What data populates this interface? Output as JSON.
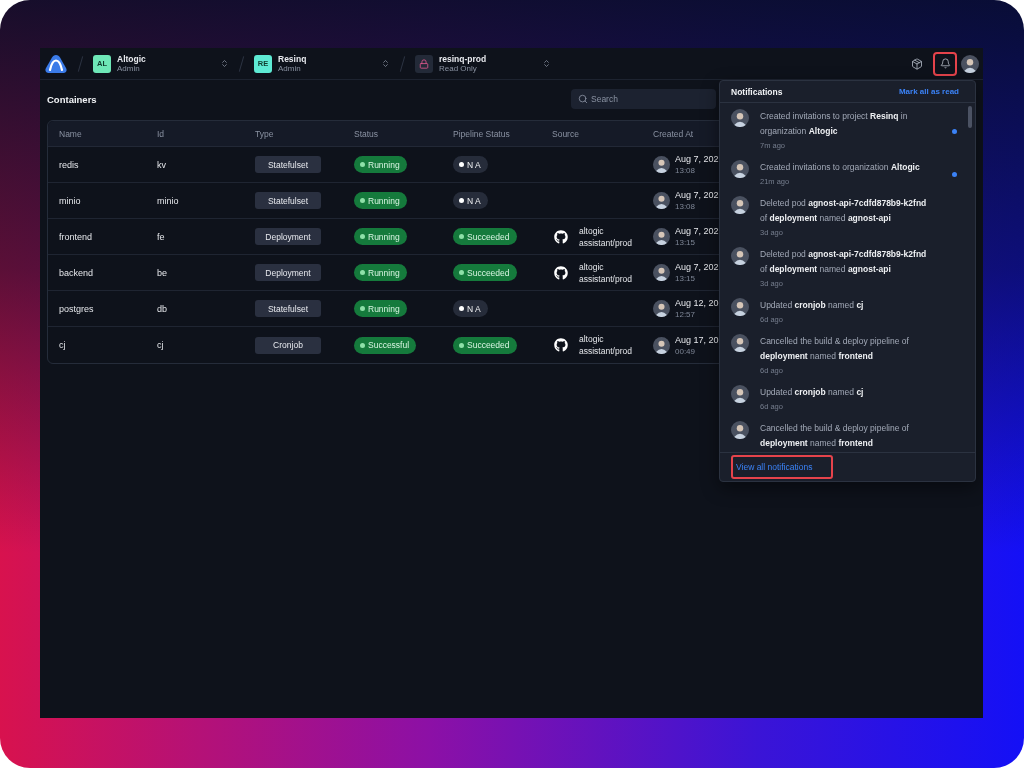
{
  "topbar": {
    "switchers": [
      {
        "kind": "initials",
        "initials": "AL",
        "color": "#6ee7b7",
        "name": "Altogic",
        "role": "Admin"
      },
      {
        "kind": "initials",
        "initials": "RE",
        "color": "#5eead4",
        "name": "Resinq",
        "role": "Admin"
      },
      {
        "kind": "lock",
        "name": "resinq-prod",
        "role": "Read Only"
      }
    ],
    "bell": {
      "highlighted": true
    }
  },
  "page": {
    "title": "Containers",
    "search": {
      "placeholder": "Search"
    }
  },
  "table": {
    "columns": [
      "Name",
      "Id",
      "Type",
      "Status",
      "Pipeline Status",
      "Source",
      "Created At"
    ],
    "rows": [
      {
        "name": "redis",
        "id": "kv",
        "type": "Statefulset",
        "status": {
          "kind": "success",
          "label": "Running"
        },
        "pipeline": {
          "kind": "neutral",
          "label": "N A"
        },
        "created": {
          "date": "Aug 7, 202",
          "time": "13:08"
        }
      },
      {
        "name": "minio",
        "id": "minio",
        "type": "Statefulset",
        "status": {
          "kind": "success",
          "label": "Running"
        },
        "pipeline": {
          "kind": "neutral",
          "label": "N A"
        },
        "created": {
          "date": "Aug 7, 202",
          "time": "13:08"
        }
      },
      {
        "name": "frontend",
        "id": "fe",
        "type": "Deployment",
        "status": {
          "kind": "success",
          "label": "Running"
        },
        "pipeline": {
          "kind": "success",
          "label": "Succeeded"
        },
        "source": {
          "kind": "github",
          "label": "altogic assistant/prod"
        },
        "created": {
          "date": "Aug 7, 202",
          "time": "13:15"
        }
      },
      {
        "name": "backend",
        "id": "be",
        "type": "Deployment",
        "status": {
          "kind": "success",
          "label": "Running"
        },
        "pipeline": {
          "kind": "success",
          "label": "Succeeded"
        },
        "source": {
          "kind": "github",
          "label": "altogic assistant/prod"
        },
        "created": {
          "date": "Aug 7, 202",
          "time": "13:15"
        }
      },
      {
        "name": "postgres",
        "id": "db",
        "type": "Statefulset",
        "status": {
          "kind": "success",
          "label": "Running"
        },
        "pipeline": {
          "kind": "neutral",
          "label": "N A"
        },
        "created": {
          "date": "Aug 12, 20",
          "time": "12:57"
        }
      },
      {
        "name": "cj",
        "id": "cj",
        "type": "Cronjob",
        "status": {
          "kind": "success",
          "label": "Successful"
        },
        "pipeline": {
          "kind": "success",
          "label": "Succeeded"
        },
        "source": {
          "kind": "github",
          "label": "altogic assistant/prod"
        },
        "created": {
          "date": "Aug 17, 20",
          "time": "00:49"
        }
      }
    ]
  },
  "notifications": {
    "title": "Notifications",
    "action": "Mark all as read",
    "items": [
      {
        "message": "Created invitations to project **Resinq** in organization **Altogic**",
        "time": "7m ago",
        "unread": true
      },
      {
        "message": "Created invitations to organization **Altogic**",
        "time": "21m ago",
        "unread": true
      },
      {
        "message": "Deleted pod **agnost-api-7cdfd878b9-k2fnd** of **deployment** named **agnost-api**",
        "time": "3d ago",
        "unread": false
      },
      {
        "message": "Deleted pod **agnost-api-7cdfd878b9-k2fnd** of **deployment** named **agnost-api**",
        "time": "3d ago",
        "unread": false
      },
      {
        "message": "Updated **cronjob** named **cj**",
        "time": "6d ago",
        "unread": false
      },
      {
        "message": "Cancelled the build & deploy pipeline of **deployment** named **frontend**",
        "time": "6d ago",
        "unread": false
      },
      {
        "message": "Updated **cronjob** named **cj**",
        "time": "6d ago",
        "unread": false
      },
      {
        "message": "Cancelled the build & deploy pipeline of **deployment** named **frontend**",
        "unread": false
      }
    ],
    "footer": {
      "label": "View all notifications",
      "highlighted": true
    }
  }
}
